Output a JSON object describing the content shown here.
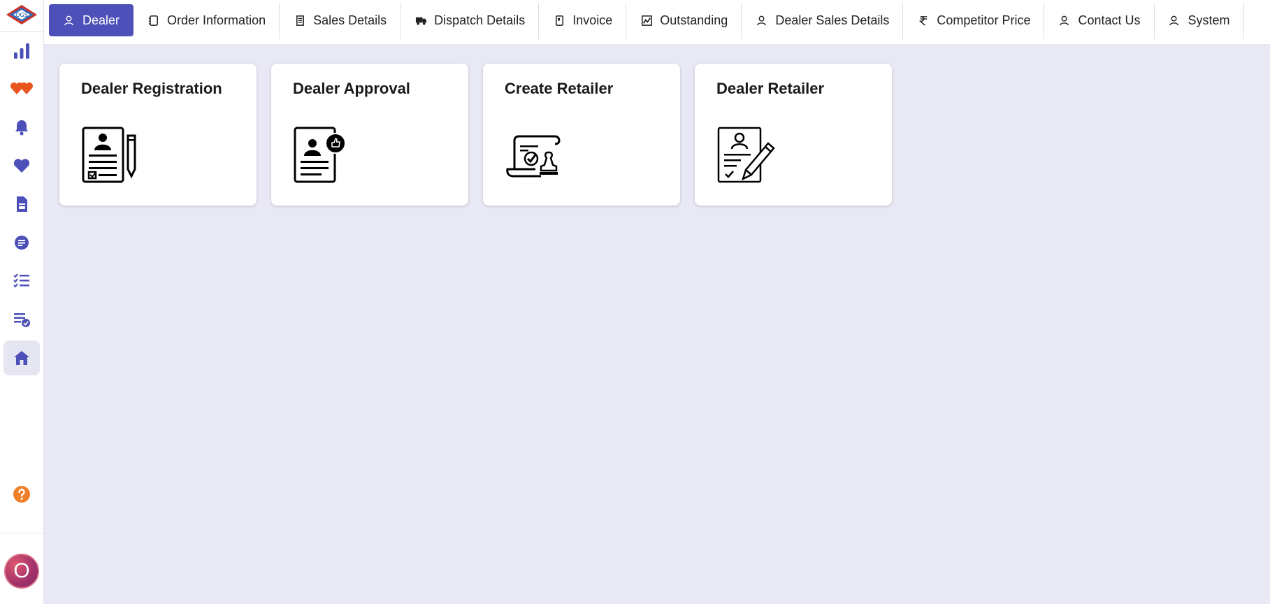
{
  "app": {
    "logo_text": "OGS",
    "avatar_letter": "O"
  },
  "colors": {
    "accent": "#4c50b8",
    "sidebar_icon": "#4c50b8",
    "background": "#e9e9f5",
    "heart_orange": "#e8541e",
    "help_orange": "#f07f2a"
  },
  "sidebar": {
    "items": [
      {
        "icon": "bar-chart-icon"
      },
      {
        "icon": "hearts-icon"
      },
      {
        "icon": "bell-icon"
      },
      {
        "icon": "heart-icon"
      },
      {
        "icon": "document-icon"
      },
      {
        "icon": "chat-lines-icon"
      },
      {
        "icon": "checklist-icon"
      },
      {
        "icon": "list-check-icon"
      },
      {
        "icon": "home-icon",
        "active": true
      }
    ],
    "help_icon": "help-icon"
  },
  "tabs": [
    {
      "label": "Dealer",
      "icon": "user-icon",
      "active": true
    },
    {
      "label": "Order Information",
      "icon": "order-icon"
    },
    {
      "label": "Sales Details",
      "icon": "receipt-icon"
    },
    {
      "label": "Dispatch Details",
      "icon": "truck-icon"
    },
    {
      "label": "Invoice",
      "icon": "invoice-icon"
    },
    {
      "label": "Outstanding",
      "icon": "chart-box-icon"
    },
    {
      "label": "Dealer Sales Details",
      "icon": "user-icon"
    },
    {
      "label": "Competitor Price",
      "icon": "rupee-icon"
    },
    {
      "label": "Contact Us",
      "icon": "user-icon"
    },
    {
      "label": "System",
      "icon": "user-icon"
    }
  ],
  "cards": [
    {
      "title": "Dealer Registration",
      "icon": "registration-form-icon"
    },
    {
      "title": "Dealer Approval",
      "icon": "approval-document-icon"
    },
    {
      "title": "Create Retailer",
      "icon": "certificate-stamp-icon"
    },
    {
      "title": "Dealer Retailer",
      "icon": "contract-sign-icon"
    }
  ]
}
